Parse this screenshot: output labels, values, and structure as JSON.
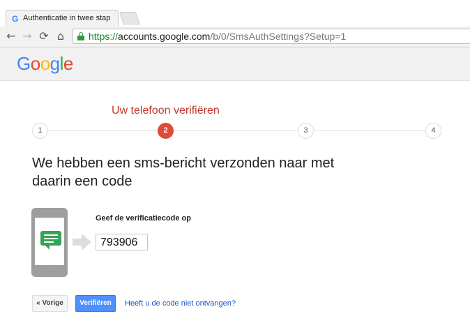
{
  "browser": {
    "tab_title": "Authenticatie in twee stap",
    "tab_favicon": "G",
    "url_scheme": "https://",
    "url_host": "accounts.google.com",
    "url_rest": "/b/0/SmsAuthSettings?Setup=1",
    "icons": {
      "back": "arrow-left-icon",
      "forward": "arrow-right-icon",
      "reload": "reload-icon",
      "home": "home-icon",
      "secure": "lock-icon"
    }
  },
  "header": {
    "logo": "Google",
    "logo_colors": [
      "#4285F4",
      "#EA4335",
      "#FBBC05",
      "#4285F4",
      "#34A853",
      "#EA4335"
    ]
  },
  "stepper": {
    "title": "Uw telefoon verifiëren",
    "steps": [
      "1",
      "2",
      "3",
      "4"
    ],
    "active": "2",
    "active_color": "#dd4b39"
  },
  "main": {
    "heading": "We hebben een sms-bericht verzonden naar met daarin een code",
    "code_label": "Geef de verificatiecode op",
    "code_value": "793906"
  },
  "buttons": {
    "back": "« Vorige",
    "verify": "Verifiëren",
    "resend_link": "Heeft u de code niet ontvangen?"
  }
}
